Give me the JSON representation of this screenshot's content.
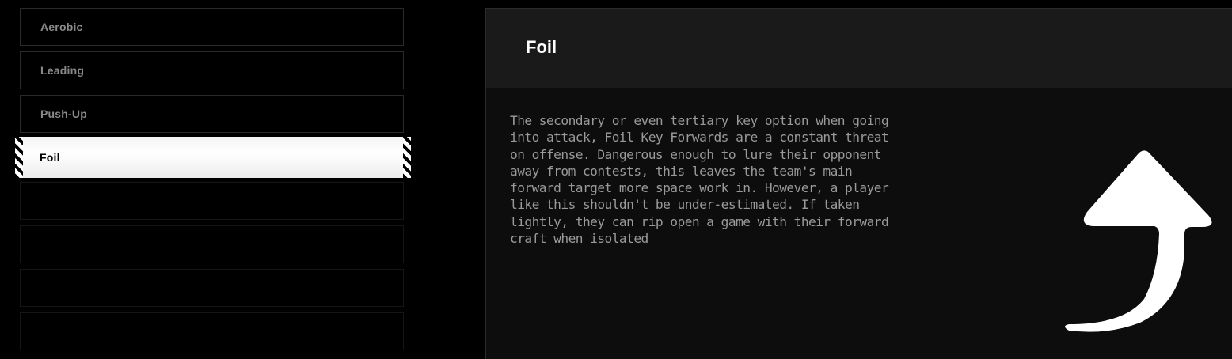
{
  "roles": {
    "items": [
      {
        "label": "Aerobic"
      },
      {
        "label": "Leading"
      },
      {
        "label": "Push-Up"
      },
      {
        "label": "Foil"
      }
    ],
    "selected_index": 3
  },
  "detail": {
    "title": "Foil",
    "description": "The secondary or even tertiary key option when going into attack, Foil Key Forwards are a constant threat on offense. Dangerous enough to lure their opponent away from contests, this leaves the team's main forward target more space work in. However, a player like this shouldn't be under-estimated. If taken lightly, they can rip open a game with their forward craft when isolated",
    "icon": "curved-up-arrow-icon"
  },
  "colors": {
    "background": "#000000",
    "panel": "#0d0d0d",
    "header": "#1a1a1a",
    "selected": "#ffffff",
    "muted_text": "#8a8a8a"
  }
}
